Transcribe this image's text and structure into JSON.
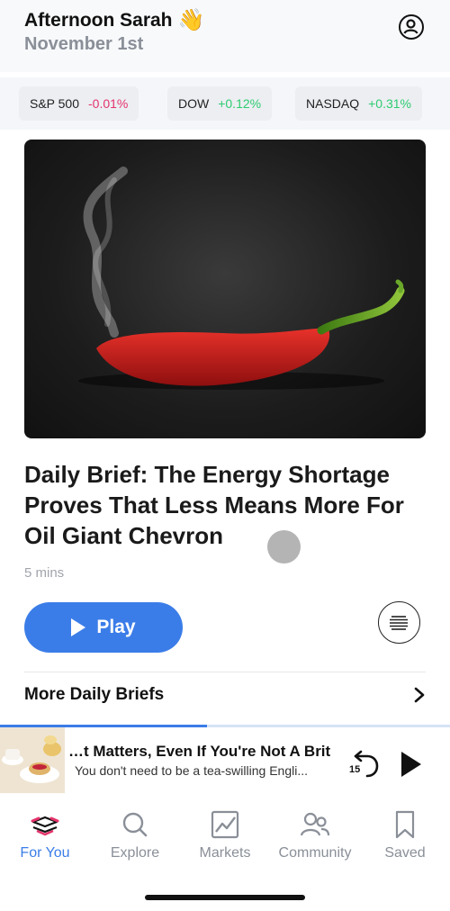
{
  "header": {
    "greeting": "Afternoon Sarah",
    "wave_emoji": "👋",
    "date": "November 1st",
    "profile_icon": "profile-icon"
  },
  "tickers": [
    {
      "name": "S&P 500",
      "change": "-0.01%",
      "direction": "down"
    },
    {
      "name": "DOW",
      "change": "+0.12%",
      "direction": "up"
    },
    {
      "name": "NASDAQ",
      "change": "+0.31%",
      "direction": "up"
    }
  ],
  "article": {
    "headline": "Daily Brief: The Energy Shortage Proves That Less Means More For Oil Giant Chevron",
    "duration": "5 mins",
    "play_label": "Play",
    "transcript_icon": "transcript-icon"
  },
  "more_briefs": {
    "label": "More Daily Briefs",
    "icon": "chevron-right-icon"
  },
  "mini_player": {
    "title": "…t Matters, Even If You're Not A Brit",
    "subtitle": "You don't need to be a tea-swilling Engli...",
    "rewind_seconds": "15",
    "progress": 0.46
  },
  "tabs": [
    {
      "label": "For You",
      "icon": "for-you-icon",
      "active": true
    },
    {
      "label": "Explore",
      "icon": "search-icon",
      "active": false
    },
    {
      "label": "Markets",
      "icon": "chart-icon",
      "active": false
    },
    {
      "label": "Community",
      "icon": "community-icon",
      "active": false
    },
    {
      "label": "Saved",
      "icon": "bookmark-icon",
      "active": false
    }
  ],
  "colors": {
    "accent": "#3b7de8",
    "negative": "#e5336b",
    "positive": "#2ecc71"
  }
}
